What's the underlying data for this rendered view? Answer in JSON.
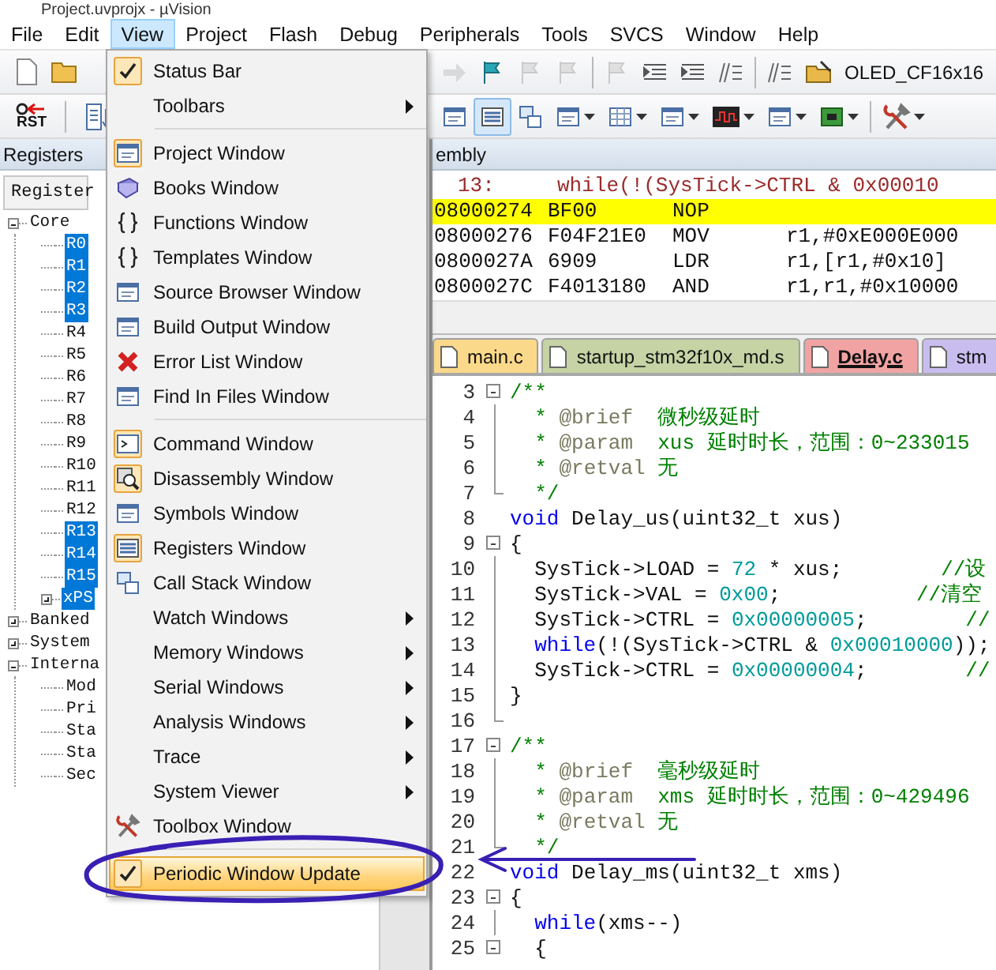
{
  "window": {
    "title": "Project.uvprojx - µVision"
  },
  "menu_bar": [
    {
      "label": "File",
      "selected": false
    },
    {
      "label": "Edit",
      "selected": false
    },
    {
      "label": "View",
      "selected": true
    },
    {
      "label": "Project",
      "selected": false
    },
    {
      "label": "Flash",
      "selected": false
    },
    {
      "label": "Debug",
      "selected": false
    },
    {
      "label": "Peripherals",
      "selected": false
    },
    {
      "label": "Tools",
      "selected": false
    },
    {
      "label": "SVCS",
      "selected": false
    },
    {
      "label": "Window",
      "selected": false
    },
    {
      "label": "Help",
      "selected": false
    }
  ],
  "toolbar_1": {
    "target": "OLED_CF16x16",
    "buttons": [
      {
        "kind": "forward",
        "disabled": true
      },
      {
        "kind": "bookmark",
        "disabled": false
      },
      {
        "kind": "prev-bookmark",
        "disabled": true
      },
      {
        "kind": "next-bookmark",
        "disabled": true
      },
      {
        "kind": "clear-bookmarks",
        "disabled": true
      },
      {
        "kind": "indent",
        "disabled": false
      },
      {
        "kind": "outdent",
        "disabled": false
      },
      {
        "kind": "comment",
        "disabled": false
      },
      {
        "kind": "uncomment",
        "disabled": false
      },
      {
        "kind": "target-options",
        "disabled": false
      }
    ]
  },
  "toolbar_2": {
    "reset_label": "RST",
    "buttons": [
      {
        "kind": "symbols",
        "selected": false,
        "dropdown": false
      },
      {
        "kind": "registers",
        "selected": true,
        "dropdown": false
      },
      {
        "kind": "callstack",
        "selected": false,
        "dropdown": false
      },
      {
        "kind": "watch",
        "selected": false,
        "dropdown": true
      },
      {
        "kind": "memory",
        "selected": false,
        "dropdown": true
      },
      {
        "kind": "serial",
        "selected": false,
        "dropdown": true
      },
      {
        "kind": "analysis",
        "selected": false,
        "dropdown": true
      },
      {
        "kind": "trace",
        "selected": false,
        "dropdown": true
      },
      {
        "kind": "sysviewer",
        "selected": false,
        "dropdown": true
      },
      {
        "kind": "toolbox",
        "selected": false,
        "dropdown": true
      }
    ]
  },
  "registers_panel": {
    "title": "Registers",
    "column": "Register",
    "tree": [
      {
        "label": "Core",
        "selected": false,
        "expanded": true,
        "children": [
          {
            "label": "R0",
            "selected": true
          },
          {
            "label": "R1",
            "selected": true
          },
          {
            "label": "R2",
            "selected": true
          },
          {
            "label": "R3",
            "selected": true
          },
          {
            "label": "R4",
            "selected": false
          },
          {
            "label": "R5",
            "selected": false
          },
          {
            "label": "R6",
            "selected": false
          },
          {
            "label": "R7",
            "selected": false
          },
          {
            "label": "R8",
            "selected": false
          },
          {
            "label": "R9",
            "selected": false
          },
          {
            "label": "R10",
            "selected": false
          },
          {
            "label": "R11",
            "selected": false
          },
          {
            "label": "R12",
            "selected": false
          },
          {
            "label": "R13",
            "selected": true
          },
          {
            "label": "R14",
            "selected": true
          },
          {
            "label": "R15",
            "selected": true
          },
          {
            "label": "xPS",
            "selected": true,
            "expanded": false
          }
        ]
      },
      {
        "label": "Banked",
        "selected": false,
        "expanded": false
      },
      {
        "label": "System",
        "selected": false,
        "expanded": false
      },
      {
        "label": "Interna",
        "selected": false,
        "expanded": true,
        "children": [
          {
            "label": "Mod",
            "selected": false
          },
          {
            "label": "Pri",
            "selected": false
          },
          {
            "label": "Sta",
            "selected": false
          },
          {
            "label": "Sta",
            "selected": false
          },
          {
            "label": "Sec",
            "selected": false
          }
        ]
      }
    ]
  },
  "disassembly": {
    "title": "embly",
    "source": {
      "line": "13:",
      "text": "while(!(SysTick->CTRL & 0x00010"
    },
    "rows": [
      {
        "address": "08000274",
        "opcode": "BF00",
        "mnemonic": "NOP",
        "current": true
      },
      {
        "address": "08000276",
        "opcode": "F04F21E0",
        "mnemonic": "MOV",
        "operands": "r1,#0xE000E000",
        "current": false
      },
      {
        "address": "0800027A",
        "opcode": "6909",
        "mnemonic": "LDR",
        "operands": "r1,[r1,#0x10]",
        "current": false
      },
      {
        "address": "0800027C",
        "opcode": "F4013180",
        "mnemonic": "AND",
        "operands": "r1,r1,#0x10000",
        "current": false
      }
    ]
  },
  "editor": {
    "tabs": [
      {
        "label": "main.c",
        "color": "#fbd98a",
        "selected": false
      },
      {
        "label": "startup_stm32f10x_md.s",
        "color": "#c5d3a5",
        "selected": false
      },
      {
        "label": "Delay.c",
        "color": "#f1a3a3",
        "selected": true
      },
      {
        "label": "stm",
        "color": "#c9bdf0",
        "selected": false
      }
    ],
    "lines": [
      {
        "num": "3",
        "kind": "fold-start",
        "tokens": [
          {
            "text": "/**",
            "kind": "comment"
          }
        ]
      },
      {
        "num": "4",
        "kind": "fold-body",
        "tokens": [
          {
            "text": "  * ",
            "kind": "comment"
          },
          {
            "text": "@brief",
            "kind": "tag"
          },
          {
            "text": "  微秒级延时",
            "kind": "comment"
          }
        ]
      },
      {
        "num": "5",
        "kind": "fold-body",
        "tokens": [
          {
            "text": "  * ",
            "kind": "comment"
          },
          {
            "text": "@param",
            "kind": "tag"
          },
          {
            "text": "  xus 延时时长，范围：0~233015",
            "kind": "comment"
          }
        ]
      },
      {
        "num": "6",
        "kind": "fold-body",
        "tokens": [
          {
            "text": "  * ",
            "kind": "comment"
          },
          {
            "text": "@retval",
            "kind": "tag"
          },
          {
            "text": " 无",
            "kind": "comment"
          }
        ]
      },
      {
        "num": "7",
        "kind": "fold-end",
        "tokens": [
          {
            "text": "  */",
            "kind": "comment"
          }
        ]
      },
      {
        "num": "8",
        "kind": "plain",
        "tokens": [
          {
            "text": "void",
            "kind": "keyword"
          },
          {
            "text": " Delay_us(uint32_t xus)",
            "kind": "plain"
          }
        ]
      },
      {
        "num": "9",
        "kind": "fold-start",
        "tokens": [
          {
            "text": "{",
            "kind": "plain"
          }
        ]
      },
      {
        "num": "10",
        "kind": "fold-body",
        "tokens": [
          {
            "text": "  SysTick->LOAD = ",
            "kind": "plain"
          },
          {
            "text": "72",
            "kind": "number"
          },
          {
            "text": " * xus;        ",
            "kind": "plain"
          },
          {
            "text": "//设",
            "kind": "comment"
          }
        ]
      },
      {
        "num": "11",
        "kind": "fold-body",
        "tokens": [
          {
            "text": "  SysTick->VAL = ",
            "kind": "plain"
          },
          {
            "text": "0x00",
            "kind": "number"
          },
          {
            "text": ";           ",
            "kind": "plain"
          },
          {
            "text": "//清空",
            "kind": "comment"
          }
        ]
      },
      {
        "num": "12",
        "kind": "fold-body",
        "tokens": [
          {
            "text": "  SysTick->CTRL = ",
            "kind": "plain"
          },
          {
            "text": "0x00000005",
            "kind": "number"
          },
          {
            "text": ";        ",
            "kind": "plain"
          },
          {
            "text": "//",
            "kind": "comment"
          }
        ]
      },
      {
        "num": "13",
        "kind": "fold-body",
        "tokens": [
          {
            "text": "  while",
            "kind": "keyword"
          },
          {
            "text": "(!(SysTick->CTRL & ",
            "kind": "plain"
          },
          {
            "text": "0x00010000",
            "kind": "number"
          },
          {
            "text": "));",
            "kind": "plain"
          }
        ]
      },
      {
        "num": "14",
        "kind": "fold-body",
        "tokens": [
          {
            "text": "  SysTick->CTRL = ",
            "kind": "plain"
          },
          {
            "text": "0x00000004",
            "kind": "number"
          },
          {
            "text": ";        ",
            "kind": "plain"
          },
          {
            "text": "//",
            "kind": "comment"
          }
        ]
      },
      {
        "num": "15",
        "kind": "fold-body",
        "tokens": [
          {
            "text": "}",
            "kind": "plain"
          }
        ]
      },
      {
        "num": "16",
        "kind": "fold-end"
      },
      {
        "num": "17",
        "kind": "fold-start",
        "tokens": [
          {
            "text": "/**",
            "kind": "comment"
          }
        ]
      },
      {
        "num": "18",
        "kind": "fold-body",
        "tokens": [
          {
            "text": "  * ",
            "kind": "comment"
          },
          {
            "text": "@brief",
            "kind": "tag"
          },
          {
            "text": "  毫秒级延时",
            "kind": "comment"
          }
        ]
      },
      {
        "num": "19",
        "kind": "fold-body",
        "tokens": [
          {
            "text": "  * ",
            "kind": "comment"
          },
          {
            "text": "@param",
            "kind": "tag"
          },
          {
            "text": "  xms 延时时长，范围：0~429496",
            "kind": "comment"
          }
        ]
      },
      {
        "num": "20",
        "kind": "fold-body",
        "tokens": [
          {
            "text": "  * ",
            "kind": "comment"
          },
          {
            "text": "@retval",
            "kind": "tag"
          },
          {
            "text": " 无",
            "kind": "comment"
          }
        ]
      },
      {
        "num": "21",
        "kind": "fold-end",
        "tokens": [
          {
            "text": "  */",
            "kind": "comment"
          }
        ]
      },
      {
        "num": "22",
        "kind": "plain",
        "tokens": [
          {
            "text": "void",
            "kind": "keyword"
          },
          {
            "text": " Delay_ms(uint32_t xms)",
            "kind": "plain"
          }
        ]
      },
      {
        "num": "23",
        "kind": "fold-start",
        "tokens": [
          {
            "text": "{",
            "kind": "plain"
          }
        ]
      },
      {
        "num": "24",
        "kind": "fold-body",
        "tokens": [
          {
            "text": "  while",
            "kind": "keyword"
          },
          {
            "text": "(xms--)",
            "kind": "plain"
          }
        ]
      },
      {
        "num": "25",
        "kind": "fold-start",
        "tokens": [
          {
            "text": "  {",
            "kind": "plain"
          }
        ]
      }
    ]
  },
  "view_menu": {
    "items": [
      {
        "kind": "item",
        "label": "Status Bar",
        "checked": true,
        "submenu": false,
        "selected": false
      },
      {
        "kind": "item",
        "label": "Toolbars",
        "submenu": true,
        "selected": false
      },
      {
        "kind": "separator"
      },
      {
        "kind": "item",
        "label": "Project Window",
        "checked": true,
        "submenu": false,
        "selected": false
      },
      {
        "kind": "item",
        "label": "Books Window",
        "checked": false,
        "submenu": false,
        "selected": false
      },
      {
        "kind": "item",
        "label": "Functions Window",
        "checked": false,
        "submenu": false,
        "selected": false
      },
      {
        "kind": "item",
        "label": "Templates Window",
        "checked": false,
        "submenu": false,
        "selected": false
      },
      {
        "kind": "item",
        "label": "Source Browser Window",
        "checked": false,
        "submenu": false,
        "selected": false
      },
      {
        "kind": "item",
        "label": "Build Output Window",
        "checked": false,
        "submenu": false,
        "selected": false
      },
      {
        "kind": "item",
        "label": "Error List Window",
        "checked": false,
        "submenu": false,
        "selected": false
      },
      {
        "kind": "item",
        "label": "Find In Files Window",
        "checked": false,
        "submenu": false,
        "selected": false
      },
      {
        "kind": "separator"
      },
      {
        "kind": "item",
        "label": "Command Window",
        "checked": true,
        "submenu": false,
        "selected": false
      },
      {
        "kind": "item",
        "label": "Disassembly Window",
        "checked": true,
        "submenu": false,
        "selected": false
      },
      {
        "kind": "item",
        "label": "Symbols Window",
        "checked": false,
        "submenu": false,
        "selected": false
      },
      {
        "kind": "item",
        "label": "Registers Window",
        "checked": true,
        "submenu": false,
        "selected": false
      },
      {
        "kind": "item",
        "label": "Call Stack Window",
        "checked": false,
        "submenu": false,
        "selected": false
      },
      {
        "kind": "item",
        "label": "Watch Windows",
        "submenu": true,
        "selected": false
      },
      {
        "kind": "item",
        "label": "Memory Windows",
        "submenu": true,
        "selected": false
      },
      {
        "kind": "item",
        "label": "Serial Windows",
        "submenu": true,
        "selected": false
      },
      {
        "kind": "item",
        "label": "Analysis Windows",
        "submenu": true,
        "selected": false
      },
      {
        "kind": "item",
        "label": "Trace",
        "submenu": true,
        "selected": false
      },
      {
        "kind": "item",
        "label": "System Viewer",
        "submenu": true,
        "selected": false
      },
      {
        "kind": "item",
        "label": "Toolbox Window",
        "checked": false,
        "submenu": false,
        "selected": false
      },
      {
        "kind": "separator"
      },
      {
        "kind": "item",
        "label": "Periodic Window Update",
        "checked": true,
        "submenu": false,
        "selected": true
      }
    ]
  }
}
